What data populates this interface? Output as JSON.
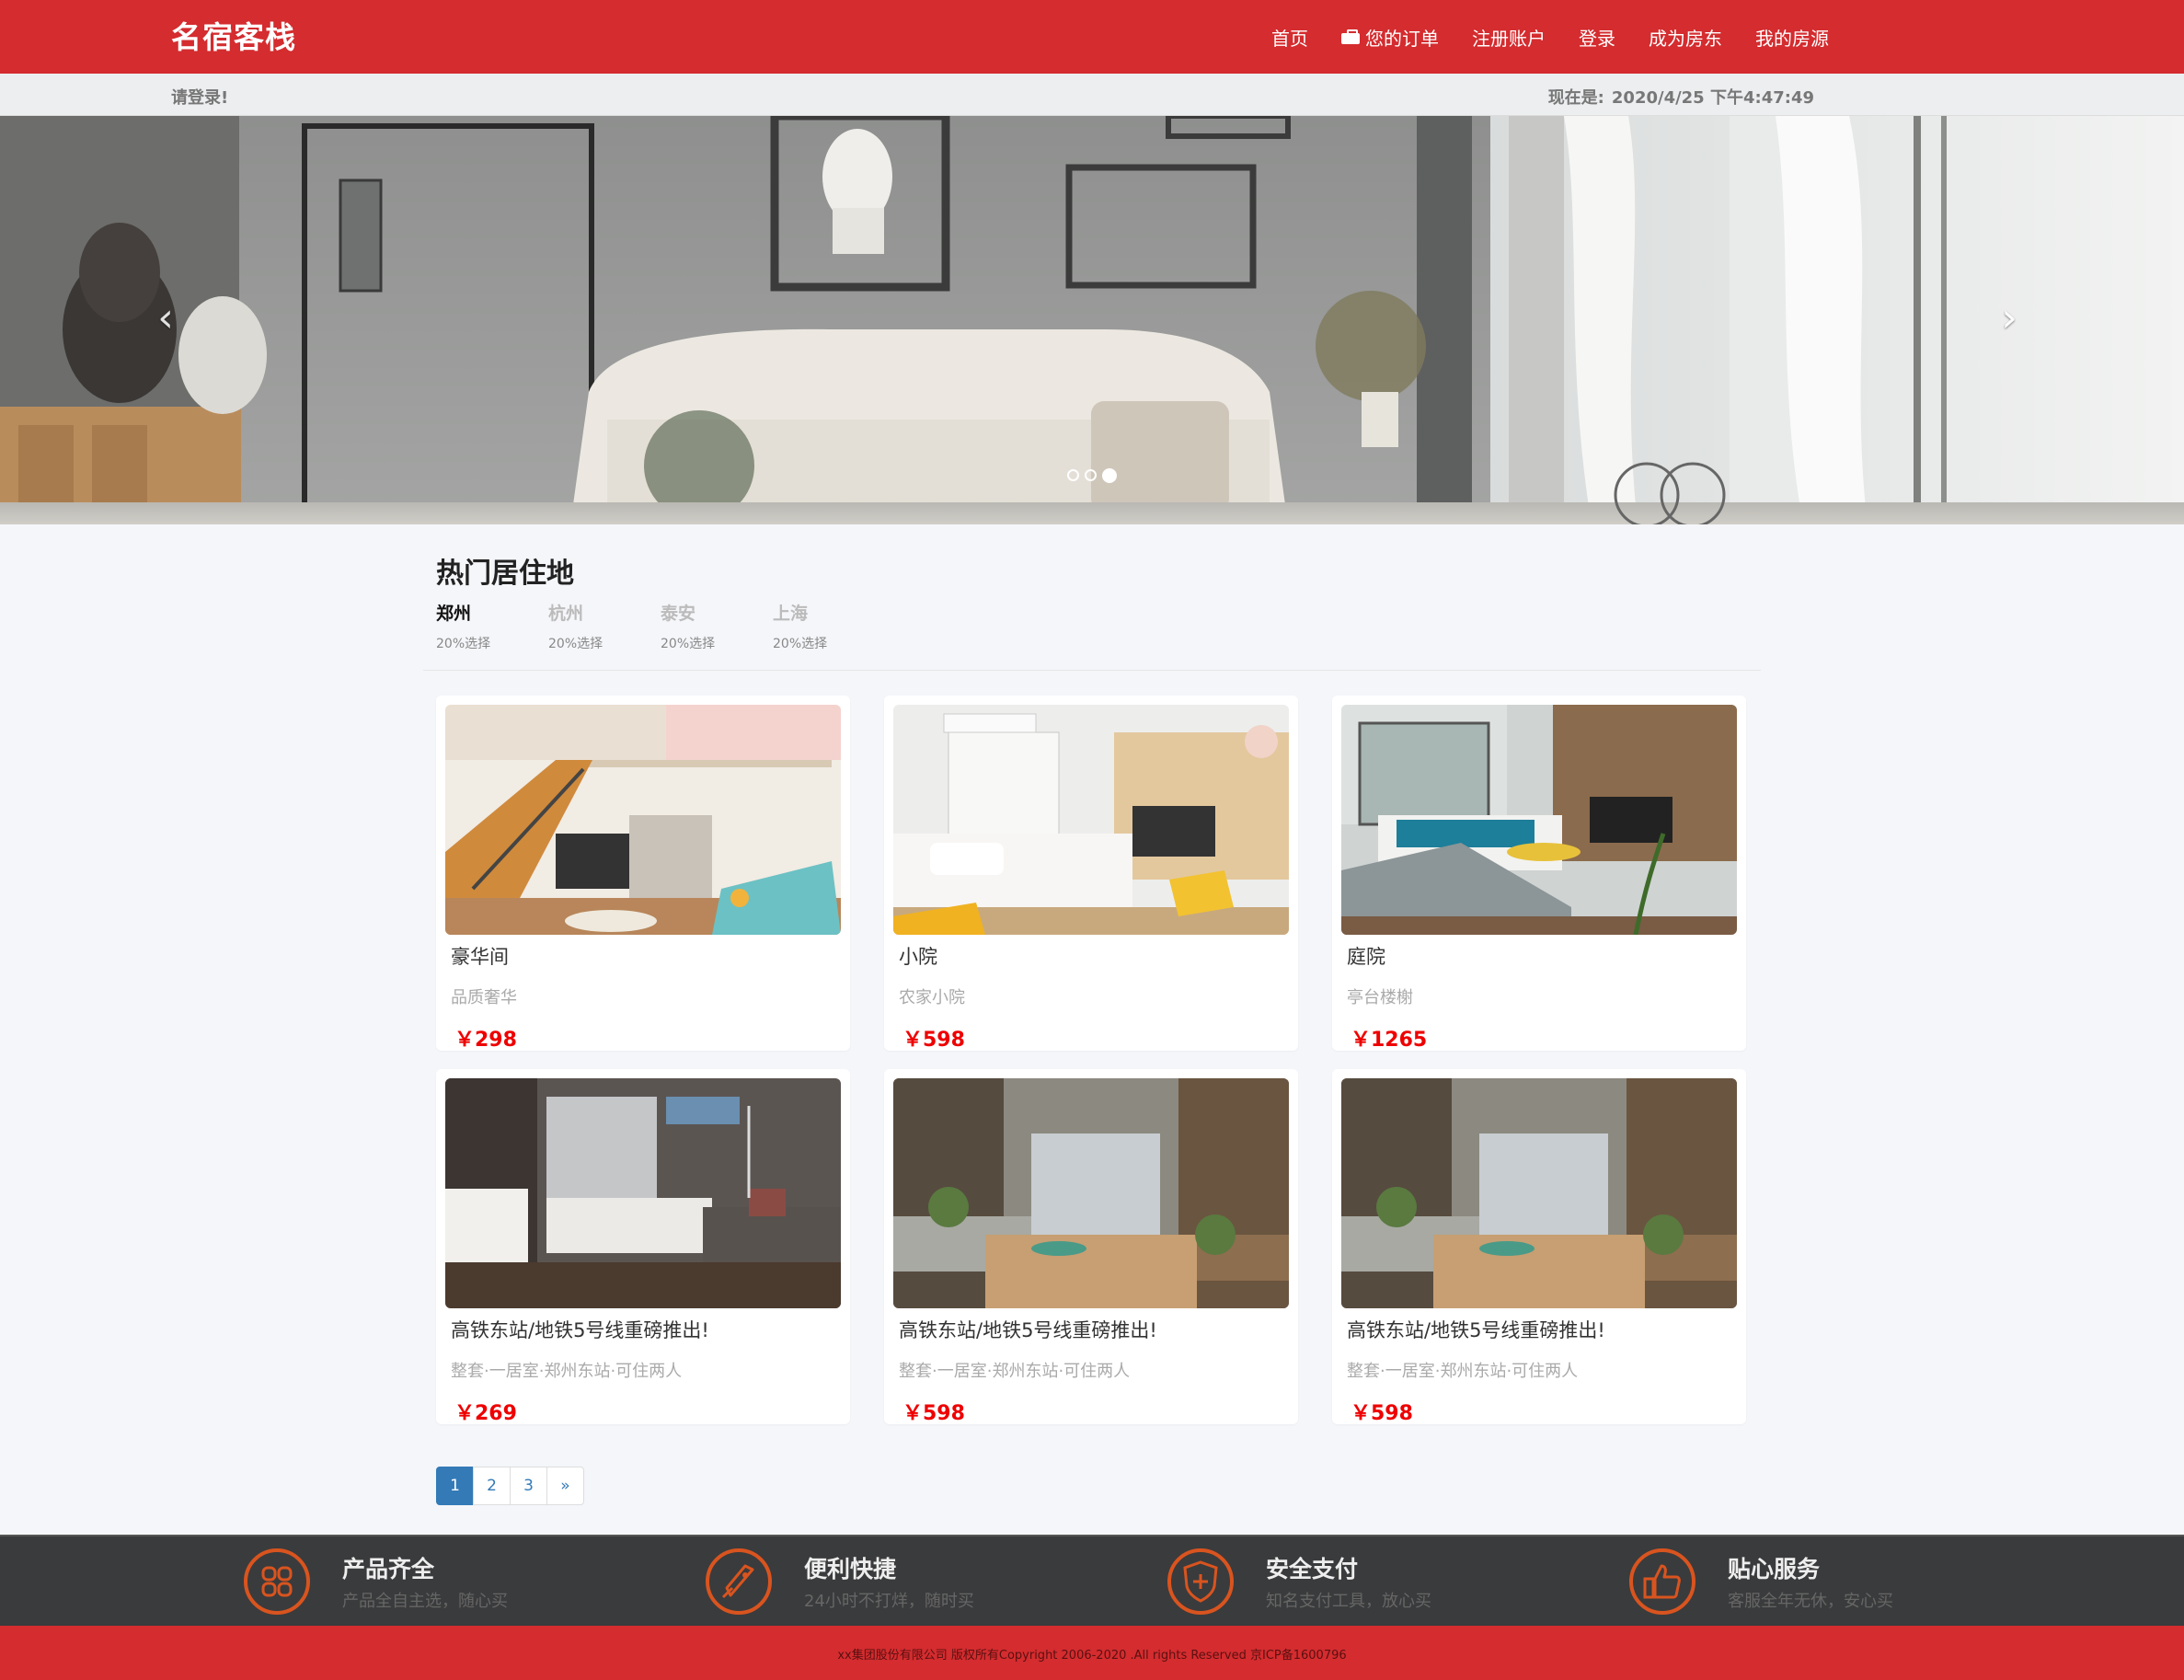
{
  "brand": "名宿客栈",
  "nav": {
    "home": "首页",
    "orders": "您的订单",
    "register": "注册账户",
    "login": "登录",
    "host": "成为房东",
    "listings": "我的房源"
  },
  "status": {
    "login_hint": "请登录!",
    "now_label": "现在是:",
    "now_value": "2020/4/25 下午4:47:49"
  },
  "hero": {
    "slide_count": 3,
    "active_slide": 3
  },
  "section": {
    "title": "热门居住地",
    "cities": [
      {
        "name": "郑州",
        "sub": "20%选择"
      },
      {
        "name": "杭州",
        "sub": "20%选择"
      },
      {
        "name": "泰安",
        "sub": "20%选择"
      },
      {
        "name": "上海",
        "sub": "20%选择"
      }
    ]
  },
  "listings": [
    {
      "title": "豪华间",
      "sub": "品质奢华",
      "price": "￥298"
    },
    {
      "title": "小院",
      "sub": "农家小院",
      "price": "￥598"
    },
    {
      "title": "庭院",
      "sub": "亭台楼榭",
      "price": "￥1265"
    },
    {
      "title": "高铁东站/地铁5号线重磅推出!",
      "sub": "整套·一居室·郑州东站·可住两人",
      "price": "￥269"
    },
    {
      "title": "高铁东站/地铁5号线重磅推出!",
      "sub": "整套·一居室·郑州东站·可住两人",
      "price": "￥598"
    },
    {
      "title": "高铁东站/地铁5号线重磅推出!",
      "sub": "整套·一居室·郑州东站·可住两人",
      "price": "￥598"
    }
  ],
  "pagination": {
    "pages": [
      "1",
      "2",
      "3"
    ],
    "next": "»",
    "active": "1"
  },
  "features": [
    {
      "title": "产品齐全",
      "sub": "产品全自主选，随心买",
      "icon": "grid-icon"
    },
    {
      "title": "便利快捷",
      "sub": "24小时不打烊，随时买",
      "icon": "rocket-icon"
    },
    {
      "title": "安全支付",
      "sub": "知名支付工具，放心买",
      "icon": "shield-icon"
    },
    {
      "title": "贴心服务",
      "sub": "客服全年无休，安心买",
      "icon": "thumbs-up-icon"
    }
  ],
  "footer": {
    "copyright": "xx集团股份有限公司 版权所有Copyright 2006-2020 .All rights Reserved 京ICP备1600796"
  },
  "colors": {
    "brand_red": "#d42c2f",
    "price_red": "#ee0000",
    "link_blue": "#337ab7"
  }
}
